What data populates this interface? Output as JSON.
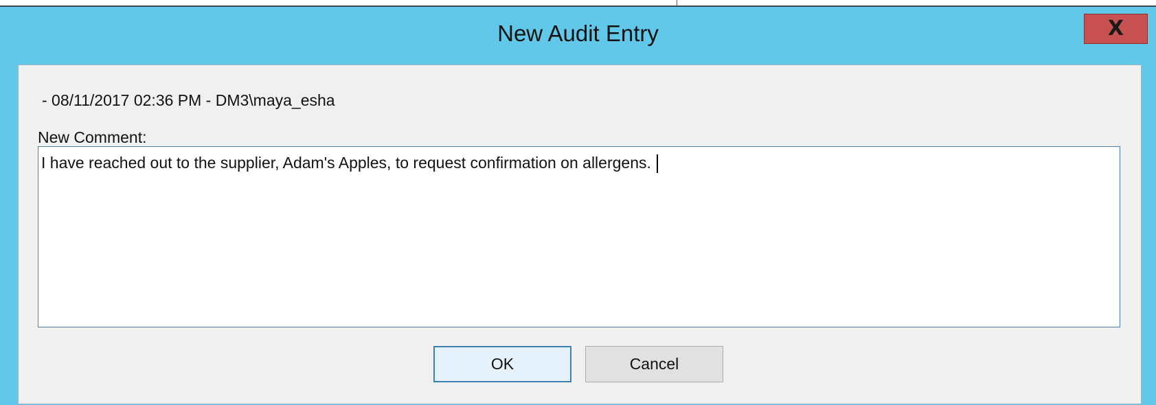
{
  "window": {
    "title": "New Audit Entry",
    "close_label": "X"
  },
  "entry": {
    "info_line": "- 08/11/2017 02:36 PM - DM3\\maya_esha",
    "comment_label": "New Comment:",
    "comment_value": "I have reached out to the supplier, Adam's Apples, to request confirmation on allergens."
  },
  "buttons": {
    "ok_label": "OK",
    "cancel_label": "Cancel"
  },
  "colors": {
    "titlebar": "#62c8ea",
    "close_button": "#c75050",
    "client_bg": "#f0f0f0",
    "ok_border": "#3c7fb1"
  }
}
